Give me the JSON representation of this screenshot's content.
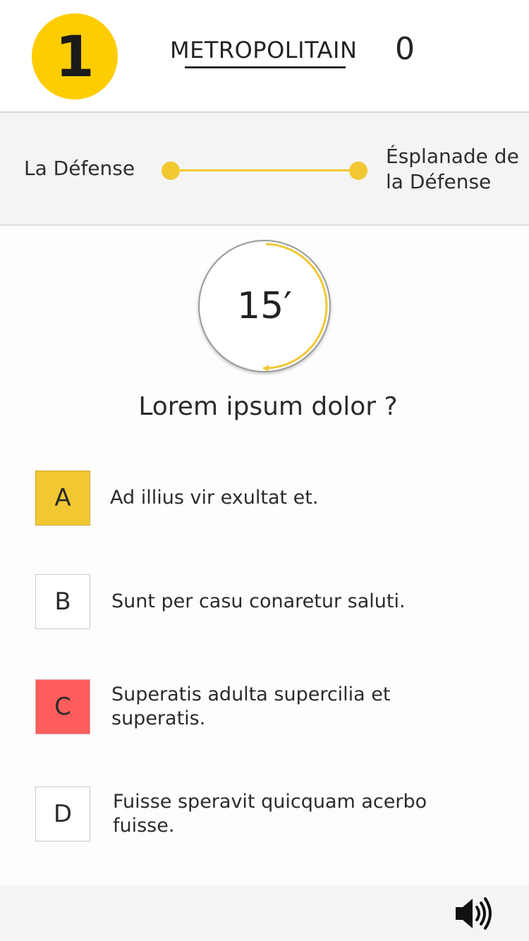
{
  "header": {
    "line_number": "1",
    "title": "METROPOLITAIN",
    "score": "0"
  },
  "route": {
    "from": "La Défense",
    "to": "Ésplanade de la Défense",
    "line_color": "#f2c832"
  },
  "timer": {
    "label": "15′",
    "accent": "#f2c832"
  },
  "question": "Lorem ipsum dolor ?",
  "answers": [
    {
      "letter": "A",
      "text": "Ad illius vir exultat et.",
      "state": "selected",
      "color": "#f2c832"
    },
    {
      "letter": "B",
      "text": "Sunt per casu conaretur saluti.",
      "state": "neutral",
      "color": "#ffffff"
    },
    {
      "letter": "C",
      "text": "Superatis adulta supercilia et superatis.",
      "state": "wrong",
      "color": "#fe5d5d"
    },
    {
      "letter": "D",
      "text": "Fuisse speravit quicquam acerbo fuisse.",
      "state": "neutral",
      "color": "#ffffff"
    }
  ],
  "footer": {
    "sound_icon": "speaker-volume-icon"
  },
  "colors": {
    "badge": "#fecd00",
    "accent": "#f2c832",
    "wrong": "#fe5d5d"
  }
}
